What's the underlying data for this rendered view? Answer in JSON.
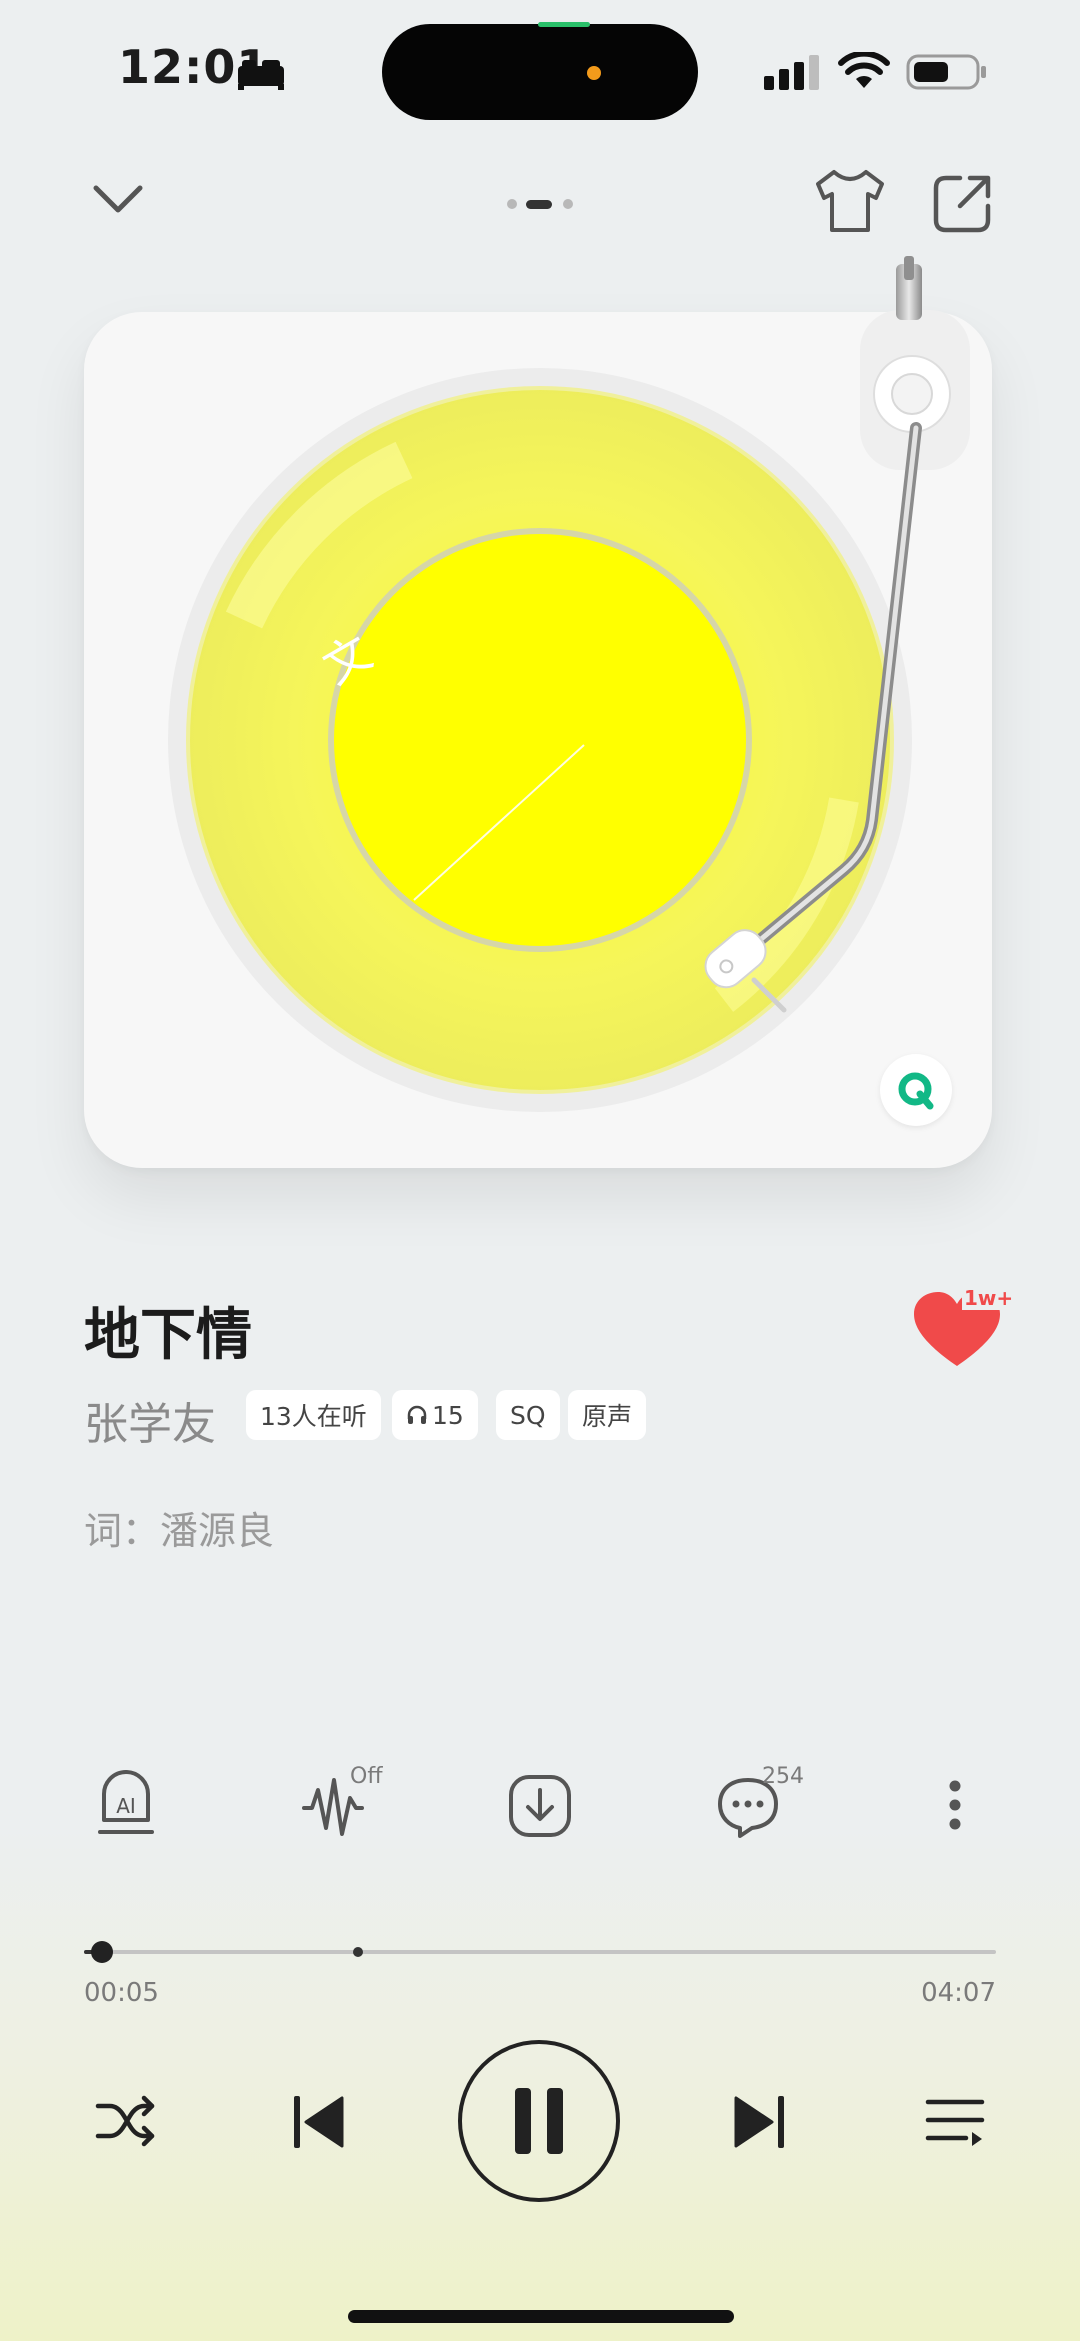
{
  "status_bar": {
    "time": "12:01"
  },
  "header": {
    "page_dots": 3,
    "active_dot": 1
  },
  "song": {
    "title": "地下情",
    "artist": "张学友",
    "tags": [
      "13人在听",
      "15",
      "SQ",
      "原声"
    ],
    "lyricist_label": "词：",
    "lyricist": "潘源良",
    "like_count": "1w+"
  },
  "actions": {
    "effect_state": "Off",
    "comment_count": "254"
  },
  "progress": {
    "elapsed": "00:05",
    "duration": "04:07",
    "fraction": 0.02,
    "buffer_mark": 0.3
  },
  "colors": {
    "disc": "#ffff1a",
    "like": "#f04a4a",
    "qq": "#12b886"
  }
}
